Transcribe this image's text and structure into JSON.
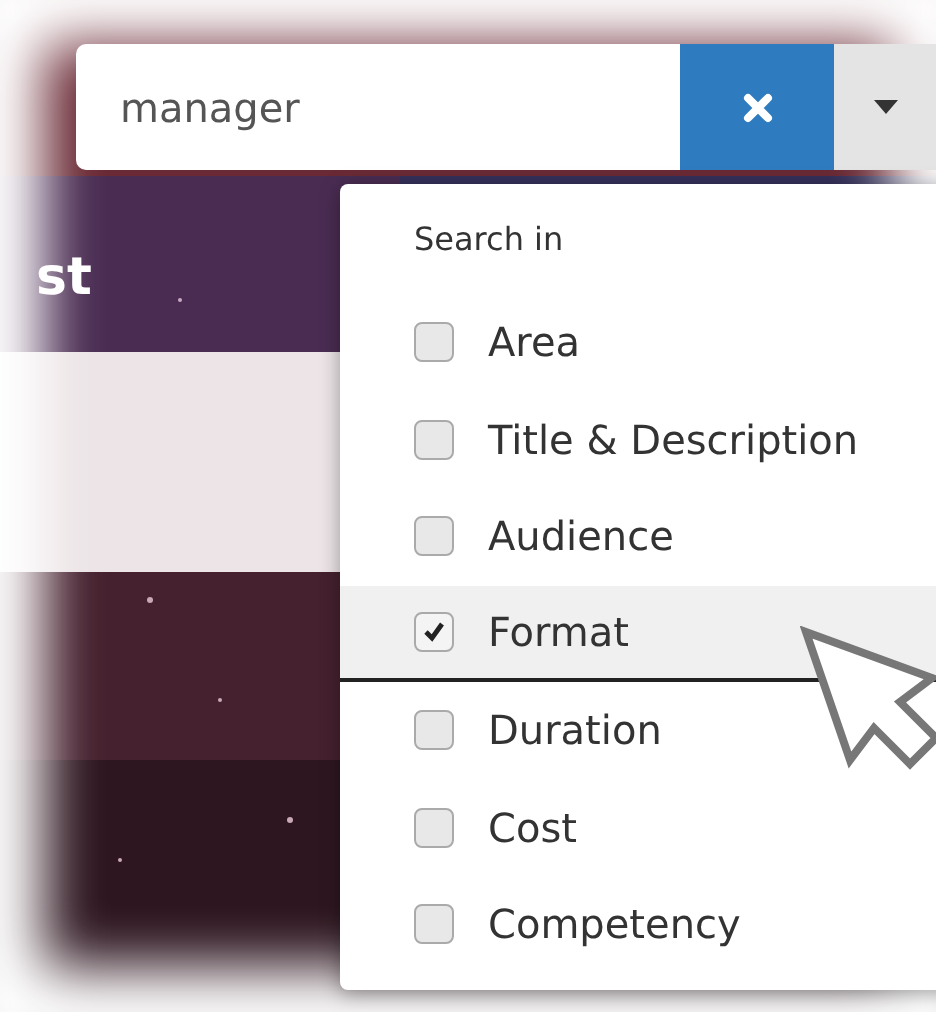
{
  "search": {
    "value": "manager"
  },
  "header": {
    "text": "st"
  },
  "search_in": {
    "title": "Search in",
    "options": [
      {
        "label": "Area",
        "checked": false,
        "hovered": false
      },
      {
        "label": "Title & Description",
        "checked": false,
        "hovered": false
      },
      {
        "label": "Audience",
        "checked": false,
        "hovered": false
      },
      {
        "label": "Format",
        "checked": true,
        "hovered": true
      },
      {
        "label": "Duration",
        "checked": false,
        "hovered": false
      },
      {
        "label": "Cost",
        "checked": false,
        "hovered": false
      },
      {
        "label": "Competency",
        "checked": false,
        "hovered": false
      }
    ]
  }
}
